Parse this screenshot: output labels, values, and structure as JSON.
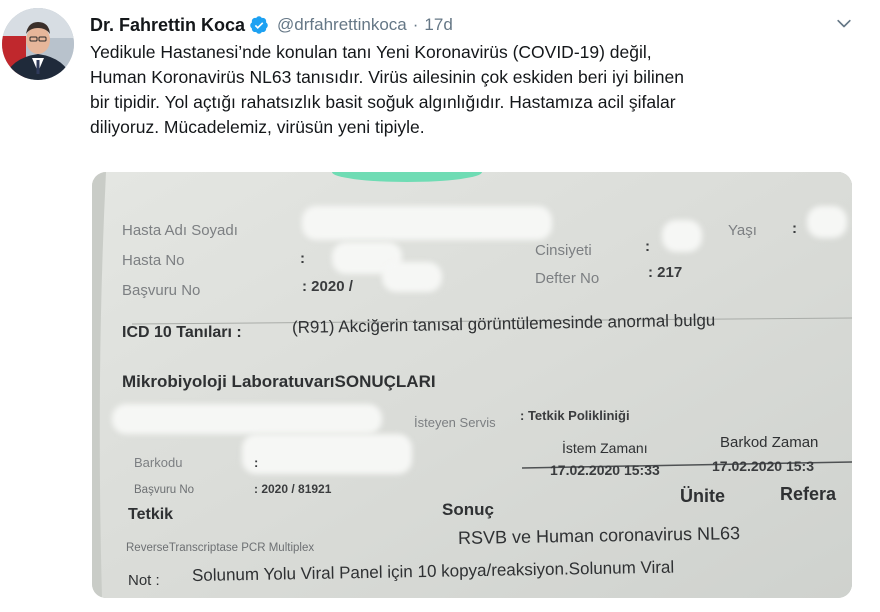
{
  "tweet": {
    "author_name": "Dr. Fahrettin Koca",
    "handle": "@drfahrettinkoca",
    "separator": "·",
    "time": "17d",
    "lines": [
      "Yedikule Hastanesi’nde konulan tanı Yeni Koronavirüs (COVID-19) değil,",
      "Human Koronavirüs NL63 tanısıdır. Virüs ailesinin çok eskiden beri iyi bilinen",
      "bir tipidir. Yol açtığı rahatsızlık basit soğuk algınlığıdır. Hastamıza acil şifalar",
      "diliyoruz. Mücadelemiz, virüsün yeni tipiyle."
    ],
    "icons": {
      "verified": "verified-badge-icon",
      "more": "chevron-down-icon"
    },
    "colors": {
      "verified": "#1da1f2",
      "secondary_text": "#657786"
    }
  },
  "document": {
    "hasta_adi": "Hasta Adı Soyadı",
    "hasta_no": "Hasta No",
    "basvuru_no": "Başvuru No",
    "basvuru_no_val": ": 2020 /",
    "cinsiyeti": "Cinsiyeti",
    "cinsiyeti_colon": ":",
    "yasi": "Yaşı",
    "yasi_colon": ":",
    "defter_no": "Defter No",
    "defter_no_val": ": 217",
    "hasta_no_colon": ":",
    "icd": "ICD 10 Tanıları :",
    "icd_val": "(R91) Akciğerin tanısal görüntülemesinde anormal bulgu",
    "lab_title": "Mikrobiyoloji LaboratuvarıSONUÇLARI",
    "isteyen_servis": "İsteyen Servis",
    "isteyen_servis_val": ": Tetkik Polikliniği",
    "istem_zamani": "İstem Zamanı",
    "istem_zamani_val": "17.02.2020 15:33",
    "barkod_zamani": "Barkod Zaman",
    "barkod_zamani_val": "17.02.2020 15:3",
    "barkodu": "Barkodu",
    "barkodu_colon": ":",
    "basvuru_no2": "Başvuru No",
    "basvuru_no2_val": ": 2020 / 81921",
    "col_tetkik": "Tetkik",
    "col_sonuc": "Sonuç",
    "col_unite": "Ünite",
    "col_referans": "Refera",
    "test_name": "ReverseTranscriptase PCR Multiplex",
    "result": "RSVB ve Human coronavirus NL63",
    "not_label": "Not :",
    "not_text": "Solunum Yolu Viral Panel için 10 kopya/reaksiyon.Solunum Viral"
  }
}
